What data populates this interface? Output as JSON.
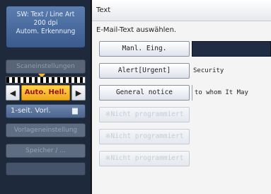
{
  "left_panel": {
    "status": {
      "line1": "SW: Text / Line Art",
      "line2": "200 dpi",
      "line3": "Autom. Erkennung"
    },
    "scan_settings_label": "Scaneinstellungen",
    "density": {
      "label": "Auto. Hell.",
      "left_arrow": "◀",
      "right_arrow": "▶"
    },
    "duplex_label": "1-seit. Vorl.",
    "duplex_icon": "▆",
    "orig_settings_label": "Vorlageneinstellung",
    "store_label": "Speicher / ..."
  },
  "right_panel": {
    "title": "Text",
    "instruction": "E-Mail-Text auswählen.",
    "rows": [
      {
        "button": "Manl. Eing.",
        "value": "",
        "enabled": true
      },
      {
        "button": "Alert[Urgent]",
        "value": "Security",
        "enabled": true
      },
      {
        "button": "General notice",
        "value": "to whom It May",
        "enabled": true
      },
      {
        "button": "※Nicht programmiert",
        "value": "",
        "enabled": false
      },
      {
        "button": "※Nicht programmiert",
        "value": "",
        "enabled": false
      },
      {
        "button": "※Nicht programmiert",
        "value": "",
        "enabled": false
      }
    ]
  }
}
